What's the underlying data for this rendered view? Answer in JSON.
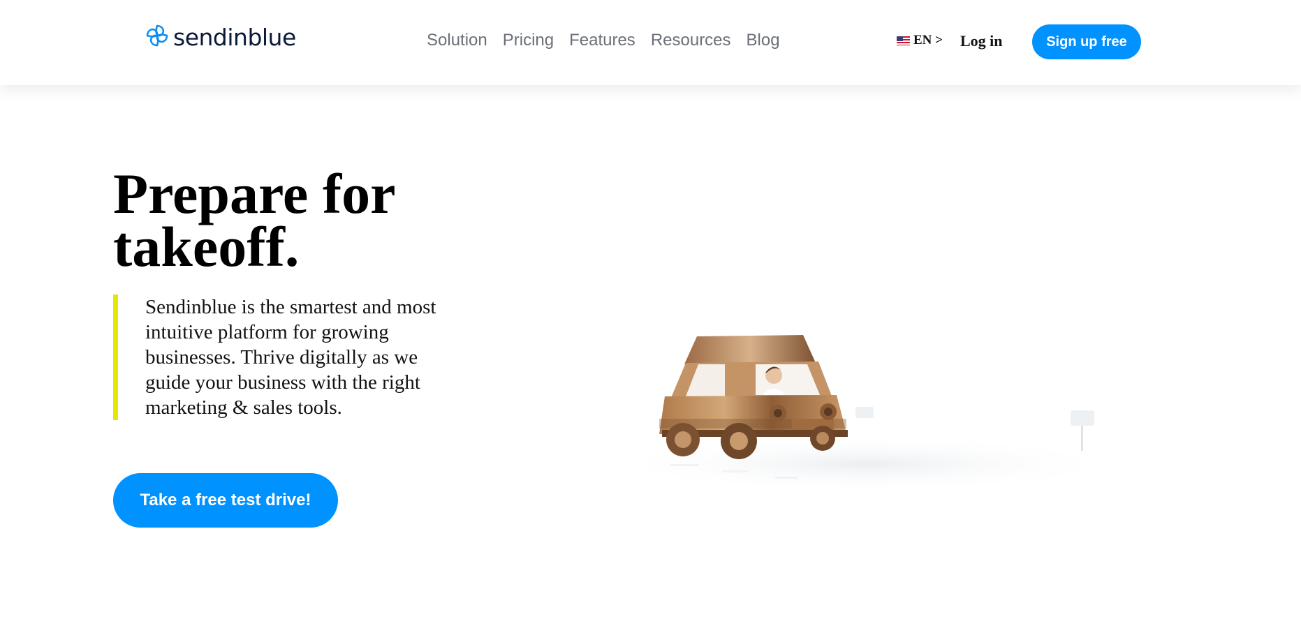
{
  "header": {
    "logo_text": "sendinblue",
    "nav": [
      "Solution",
      "Pricing",
      "Features",
      "Resources",
      "Blog"
    ],
    "language": "EN >",
    "login": "Log in",
    "signup": "Sign up free"
  },
  "hero": {
    "headline": "Prepare for takeoff.",
    "description": "Sendinblue is the smartest and most intuitive platform for growing businesses. Thrive digitally as we guide your business with the right marketing & sales tools.",
    "cta": "Take a free test drive!"
  },
  "colors": {
    "brand_blue": "#0092ff",
    "accent_yellow": "#e6e600",
    "logo_navy": "#0b1a3b"
  },
  "icons": [
    "sendinblue-logo-icon",
    "us-flag-icon",
    "wooden-car-illustration"
  ]
}
